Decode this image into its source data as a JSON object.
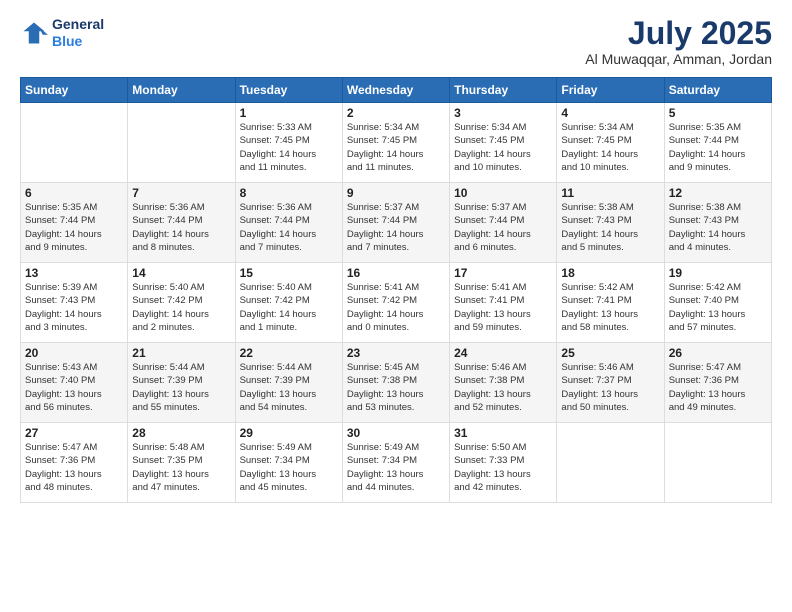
{
  "header": {
    "logo_line1": "General",
    "logo_line2": "Blue",
    "month": "July 2025",
    "location": "Al Muwaqqar, Amman, Jordan"
  },
  "days_of_week": [
    "Sunday",
    "Monday",
    "Tuesday",
    "Wednesday",
    "Thursday",
    "Friday",
    "Saturday"
  ],
  "weeks": [
    [
      {
        "day": "",
        "info": ""
      },
      {
        "day": "",
        "info": ""
      },
      {
        "day": "1",
        "info": "Sunrise: 5:33 AM\nSunset: 7:45 PM\nDaylight: 14 hours\nand 11 minutes."
      },
      {
        "day": "2",
        "info": "Sunrise: 5:34 AM\nSunset: 7:45 PM\nDaylight: 14 hours\nand 11 minutes."
      },
      {
        "day": "3",
        "info": "Sunrise: 5:34 AM\nSunset: 7:45 PM\nDaylight: 14 hours\nand 10 minutes."
      },
      {
        "day": "4",
        "info": "Sunrise: 5:34 AM\nSunset: 7:45 PM\nDaylight: 14 hours\nand 10 minutes."
      },
      {
        "day": "5",
        "info": "Sunrise: 5:35 AM\nSunset: 7:44 PM\nDaylight: 14 hours\nand 9 minutes."
      }
    ],
    [
      {
        "day": "6",
        "info": "Sunrise: 5:35 AM\nSunset: 7:44 PM\nDaylight: 14 hours\nand 9 minutes."
      },
      {
        "day": "7",
        "info": "Sunrise: 5:36 AM\nSunset: 7:44 PM\nDaylight: 14 hours\nand 8 minutes."
      },
      {
        "day": "8",
        "info": "Sunrise: 5:36 AM\nSunset: 7:44 PM\nDaylight: 14 hours\nand 7 minutes."
      },
      {
        "day": "9",
        "info": "Sunrise: 5:37 AM\nSunset: 7:44 PM\nDaylight: 14 hours\nand 7 minutes."
      },
      {
        "day": "10",
        "info": "Sunrise: 5:37 AM\nSunset: 7:44 PM\nDaylight: 14 hours\nand 6 minutes."
      },
      {
        "day": "11",
        "info": "Sunrise: 5:38 AM\nSunset: 7:43 PM\nDaylight: 14 hours\nand 5 minutes."
      },
      {
        "day": "12",
        "info": "Sunrise: 5:38 AM\nSunset: 7:43 PM\nDaylight: 14 hours\nand 4 minutes."
      }
    ],
    [
      {
        "day": "13",
        "info": "Sunrise: 5:39 AM\nSunset: 7:43 PM\nDaylight: 14 hours\nand 3 minutes."
      },
      {
        "day": "14",
        "info": "Sunrise: 5:40 AM\nSunset: 7:42 PM\nDaylight: 14 hours\nand 2 minutes."
      },
      {
        "day": "15",
        "info": "Sunrise: 5:40 AM\nSunset: 7:42 PM\nDaylight: 14 hours\nand 1 minute."
      },
      {
        "day": "16",
        "info": "Sunrise: 5:41 AM\nSunset: 7:42 PM\nDaylight: 14 hours\nand 0 minutes."
      },
      {
        "day": "17",
        "info": "Sunrise: 5:41 AM\nSunset: 7:41 PM\nDaylight: 13 hours\nand 59 minutes."
      },
      {
        "day": "18",
        "info": "Sunrise: 5:42 AM\nSunset: 7:41 PM\nDaylight: 13 hours\nand 58 minutes."
      },
      {
        "day": "19",
        "info": "Sunrise: 5:42 AM\nSunset: 7:40 PM\nDaylight: 13 hours\nand 57 minutes."
      }
    ],
    [
      {
        "day": "20",
        "info": "Sunrise: 5:43 AM\nSunset: 7:40 PM\nDaylight: 13 hours\nand 56 minutes."
      },
      {
        "day": "21",
        "info": "Sunrise: 5:44 AM\nSunset: 7:39 PM\nDaylight: 13 hours\nand 55 minutes."
      },
      {
        "day": "22",
        "info": "Sunrise: 5:44 AM\nSunset: 7:39 PM\nDaylight: 13 hours\nand 54 minutes."
      },
      {
        "day": "23",
        "info": "Sunrise: 5:45 AM\nSunset: 7:38 PM\nDaylight: 13 hours\nand 53 minutes."
      },
      {
        "day": "24",
        "info": "Sunrise: 5:46 AM\nSunset: 7:38 PM\nDaylight: 13 hours\nand 52 minutes."
      },
      {
        "day": "25",
        "info": "Sunrise: 5:46 AM\nSunset: 7:37 PM\nDaylight: 13 hours\nand 50 minutes."
      },
      {
        "day": "26",
        "info": "Sunrise: 5:47 AM\nSunset: 7:36 PM\nDaylight: 13 hours\nand 49 minutes."
      }
    ],
    [
      {
        "day": "27",
        "info": "Sunrise: 5:47 AM\nSunset: 7:36 PM\nDaylight: 13 hours\nand 48 minutes."
      },
      {
        "day": "28",
        "info": "Sunrise: 5:48 AM\nSunset: 7:35 PM\nDaylight: 13 hours\nand 47 minutes."
      },
      {
        "day": "29",
        "info": "Sunrise: 5:49 AM\nSunset: 7:34 PM\nDaylight: 13 hours\nand 45 minutes."
      },
      {
        "day": "30",
        "info": "Sunrise: 5:49 AM\nSunset: 7:34 PM\nDaylight: 13 hours\nand 44 minutes."
      },
      {
        "day": "31",
        "info": "Sunrise: 5:50 AM\nSunset: 7:33 PM\nDaylight: 13 hours\nand 42 minutes."
      },
      {
        "day": "",
        "info": ""
      },
      {
        "day": "",
        "info": ""
      }
    ]
  ]
}
